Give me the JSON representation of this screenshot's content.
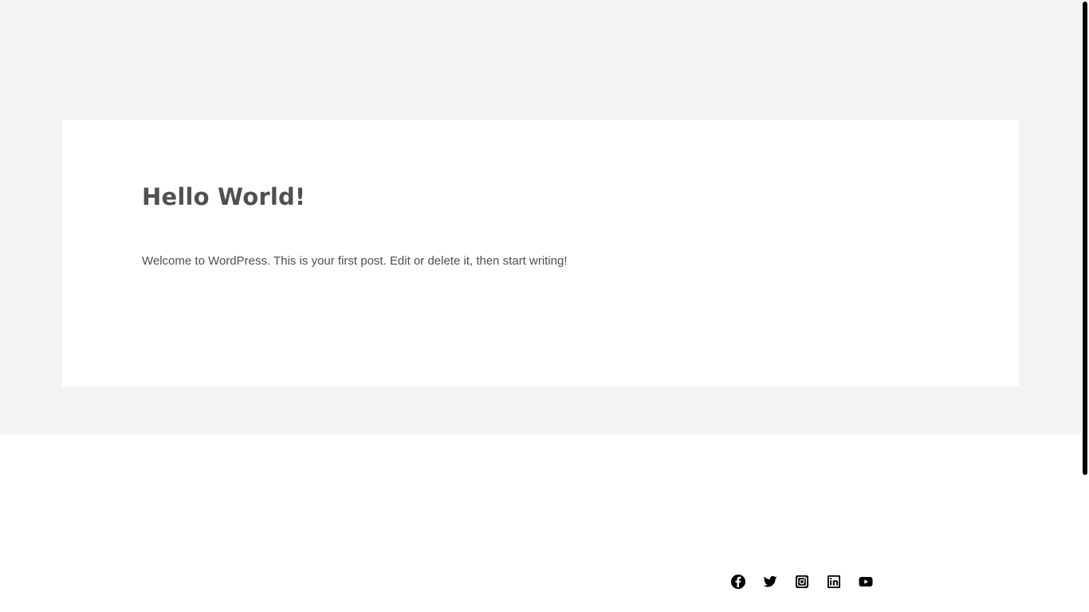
{
  "post": {
    "title": "Hello World!",
    "body": "Welcome to WordPress. This is your first post. Edit or delete it, then start writing!"
  },
  "footer": {
    "social_icons": [
      "facebook-icon",
      "twitter-icon",
      "instagram-icon",
      "linkedin-icon",
      "youtube-icon"
    ]
  },
  "colors": {
    "page_band": "#f3f3f3",
    "card": "#ffffff",
    "title_text": "#505050",
    "body_text": "#4f4f4f",
    "icon": "#000000"
  }
}
